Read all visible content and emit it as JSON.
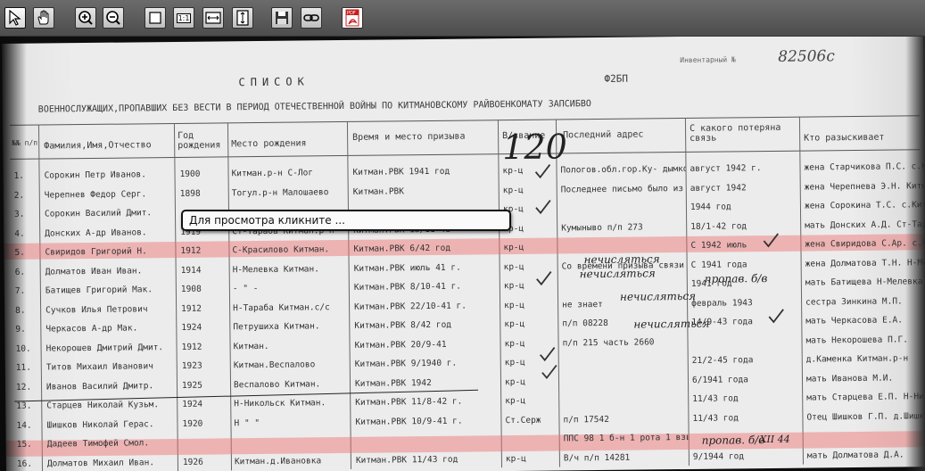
{
  "toolbar": {
    "buttons": [
      {
        "name": "select-tool-button",
        "icon": "cursor-arrow-icon"
      },
      {
        "name": "pan-tool-button",
        "icon": "hand-icon"
      },
      {
        "name": "zoom-in-button",
        "icon": "zoom-in-icon"
      },
      {
        "name": "zoom-out-button",
        "icon": "zoom-out-icon"
      },
      {
        "name": "fit-page-button",
        "icon": "page-icon"
      },
      {
        "name": "actual-size-button",
        "icon": "actual-size-icon",
        "label": "1:1"
      },
      {
        "name": "fit-width-button",
        "icon": "fit-width-icon"
      },
      {
        "name": "fit-height-button",
        "icon": "fit-height-icon"
      },
      {
        "name": "save-button",
        "icon": "floppy-disk-icon"
      },
      {
        "name": "link-button",
        "icon": "link-icon"
      },
      {
        "name": "pdf-export-button",
        "icon": "pdf-icon",
        "label": "PDF"
      }
    ]
  },
  "document": {
    "stamp_number": "82506с",
    "archive_stamp": "Инвентарный №",
    "title": "СПИСОК",
    "form_code": "Ф2БП",
    "subtitle": "ВОЕННОСЛУЖАЩИХ,ПРОПАВШИХ БЕЗ ВЕСТИ В ПЕРИОД ОТЕЧЕСТВЕННОЙ ВОЙНЫ ПО КИТМАНОВСКОМУ РАЙВОЕНКОМАТУ ЗАПСИБВО",
    "columns": [
      "№№ п/п",
      "Фамилия,Имя,Отчество",
      "Год рождения",
      "Место рождения",
      "Время и место призыва",
      "В/звание",
      "Последний адрес",
      "С какого потеряна связь",
      "Кто разыскивает"
    ],
    "rows": [
      {
        "n": "1.",
        "name": "Сорокин Петр Иванов.",
        "year": "1900",
        "birthplace": "Китман.р-н С-Лог",
        "draft": "Китман.РВК 1941 год",
        "rank": "кр-ц",
        "address": "Пологов.обл.гор.Ку- дымкор З/Г 2572",
        "lost": "август 1942 г.",
        "seeker": "жена Старчикова П.С. с.Китманово"
      },
      {
        "n": "2.",
        "name": "Черепнев Федор Серг.",
        "year": "1898",
        "birthplace": "Тогул.р-н Малошаево",
        "draft": "Китман.РВК",
        "rank": "кр-ц",
        "address": "Последнее письмо было из Под Воронежа п/п 33 8??",
        "lost": "август 1942",
        "seeker": "жена Черепнева Э.Н. Китман.р-н Б-Талова"
      },
      {
        "n": "3.",
        "name": "Сорокин Василий Дмит.",
        "year": "",
        "birthplace": "",
        "draft": "",
        "rank": "кр-ц",
        "address": "",
        "lost": "1944 год",
        "seeker": "жена Сорокина Т.С. с.Китманово"
      },
      {
        "n": "4.",
        "name": "Донских А-др Иванов.",
        "year": "1919",
        "birthplace": "Ст-Тараба Китман.р-н",
        "draft": "Китман.РВК 13/11-41",
        "rank": "кр-ц",
        "address": "Кумыныво п/п 273",
        "lost": "18/1-42 год",
        "seeker": "мать Донских А.Д. Ст-Тараба"
      },
      {
        "n": "5.",
        "name": "Свиридов Григорий Н.",
        "year": "1912",
        "birthplace": "С-Красилово Китман.",
        "draft": "Китман.РВК 6/42 год",
        "rank": "кр-ц",
        "address": "",
        "lost": "С 1942 июль",
        "seeker": "жена Свиридова С.Ар. с.Красилово"
      },
      {
        "n": "6.",
        "name": "Долматов Иван Иван.",
        "year": "1914",
        "birthplace": "Н-Мелевка Китман.",
        "draft": "Китман.РВК июль 41 г.",
        "rank": "кр-ц",
        "address": "Со времени призыва связи нет",
        "lost": "С 1941 года",
        "seeker": "жена Долматова Т.Н. Н-Мелевка Китман.р-н"
      },
      {
        "n": "7.",
        "name": "Батищев Григорий Мак.",
        "year": "1908",
        "birthplace": "- \" -",
        "draft": "Китман.РВК 8/10-41 г.",
        "rank": "кр-ц",
        "address": "",
        "lost": "1941 год",
        "seeker": "мать Батищева Н-Мелевка"
      },
      {
        "n": "8.",
        "name": "Сучков Илья Петрович",
        "year": "1912",
        "birthplace": "Н-Тараба Китман.с/с",
        "draft": "Китман.РВК 22/10-41 г.",
        "rank": "кр-ц",
        "address": "не знает",
        "lost": "февраль 1943",
        "seeker": "сестра Зинкина М.П."
      },
      {
        "n": "9.",
        "name": "Черкасов А-др Мак.",
        "year": "1924",
        "birthplace": "Петрушиха Китман.",
        "draft": "Китман.РВК 8/42 год",
        "rank": "кр-ц",
        "address": "п/п 08228",
        "lost": "14/9-43 года",
        "seeker": "мать Черкасова Е.А."
      },
      {
        "n": "10.",
        "name": "Некорошев Дмитрий Дмит.",
        "year": "1912",
        "birthplace": "Китман.",
        "draft": "Китман.РВК 20/9-41",
        "rank": "кр-ц",
        "address": "п/п 215 часть 2660",
        "lost": "",
        "seeker": "мать Некорошева П.Г."
      },
      {
        "n": "11.",
        "name": "Титов Михаил Иванович",
        "year": "1923",
        "birthplace": "Китман.Веспалово",
        "draft": "Китман.РВК 9/1940 г.",
        "rank": "кр-ц",
        "address": "",
        "lost": "21/2-45 года",
        "seeker": "д.Каменка Китман.р-н"
      },
      {
        "n": "12.",
        "name": "Иванов Василий Дмитр.",
        "year": "1925",
        "birthplace": "Веспалово Китман.",
        "draft": "Китман.РВК 1942",
        "rank": "кр-ц",
        "address": "",
        "lost": "6/1941 года",
        "seeker": "мать Иванова М.И."
      },
      {
        "n": "13.",
        "name": "Старцев Николай Кузьм.",
        "year": "1924",
        "birthplace": "Н-Никольск Китман.",
        "draft": "Китман.РВК 11/8-42 г.",
        "rank": "кр-ц",
        "address": "",
        "lost": "11/43 год",
        "seeker": "мать Старцева Е.П. Н-Никольск Китман.р-н"
      },
      {
        "n": "14.",
        "name": "Шишков Николай Герас.",
        "year": "1920",
        "birthplace": "Н \" \"",
        "draft": "Китман.РВК 10/9-41 г.",
        "rank": "Ст.Серж",
        "address": "п/п 17542",
        "lost": "11/43 год",
        "seeker": "Отец Шишков Г.П. д.Шишкова Н-Никольск"
      },
      {
        "n": "15.",
        "name": "Дадеев Тимофей Смол.",
        "year": "",
        "birthplace": "",
        "draft": "",
        "rank": "",
        "address": "ППС 98 1 б-н 1 рота 1 взвод",
        "lost": "",
        "seeker": ""
      },
      {
        "n": "16.",
        "name": "Долматов Михаил Иван.",
        "year": "1926",
        "birthplace": "Китман.д.Ивановка",
        "draft": "Китман.РВК 11/43 год",
        "rank": "кр-ц",
        "address": "В/ч п/п 14281",
        "lost": "9/1944 год",
        "seeker": "мать Долматова Д.А."
      }
    ],
    "handwritten": [
      {
        "text": "120",
        "key": "h1"
      },
      {
        "text": "нечисляться",
        "key": "h2"
      },
      {
        "text": "нечисляться",
        "key": "h3"
      },
      {
        "text": "пропав. б/в",
        "key": "h4"
      },
      {
        "text": "нечисляться",
        "key": "h5"
      },
      {
        "text": "нечисляться",
        "key": "h6"
      },
      {
        "text": "пропав. б/в",
        "key": "h7"
      },
      {
        "text": "XII 44",
        "key": "h8"
      }
    ]
  },
  "tooltip": {
    "text": "Для просмотра кликните ..."
  },
  "colors": {
    "toolbar_bg": "#5c5c5c",
    "highlight": "#f06e6e",
    "pdf_red": "#c81e1e"
  }
}
